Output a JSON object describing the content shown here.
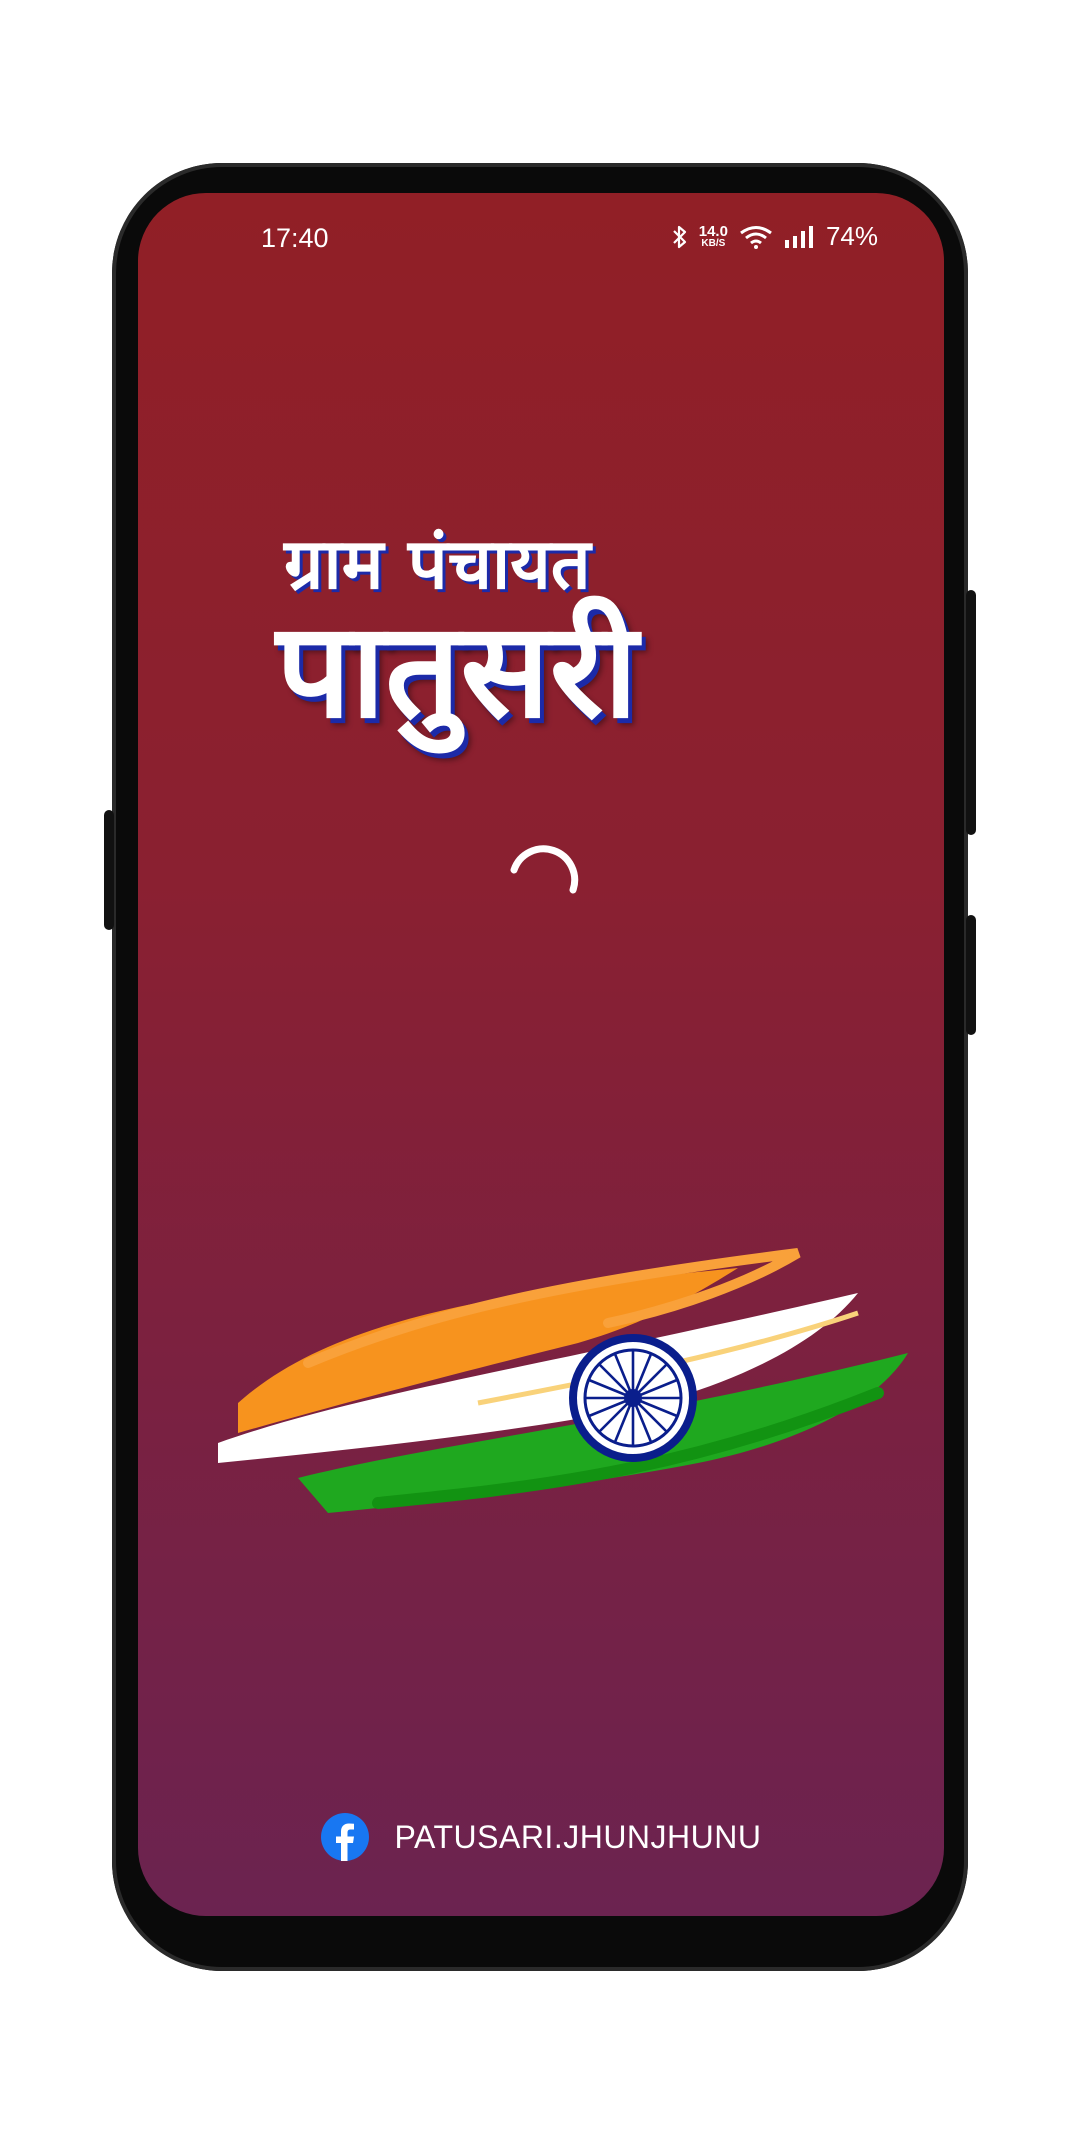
{
  "status_bar": {
    "time": "17:40",
    "network_speed_value": "14.0",
    "network_speed_unit": "KB/S",
    "battery": "74%",
    "icons": [
      "bluetooth-icon",
      "wifi-icon",
      "signal-icon"
    ]
  },
  "title": {
    "line1": "ग्राम पंचायत",
    "line2": "पातुसरी"
  },
  "loader": {
    "icon": "loading-spinner-icon"
  },
  "flag": {
    "icon": "india-flag-brush-icon"
  },
  "footer": {
    "icon": "facebook-icon",
    "label": "PATUSARI.JHUNJHUNU"
  },
  "colors": {
    "background_top": "#911f26",
    "background_bottom": "#6b2350",
    "title_shadow": "#1c2aa8",
    "saffron": "#f7931e",
    "green": "#1fa81f",
    "chakra": "#0a1e8c",
    "facebook": "#1877f2"
  }
}
